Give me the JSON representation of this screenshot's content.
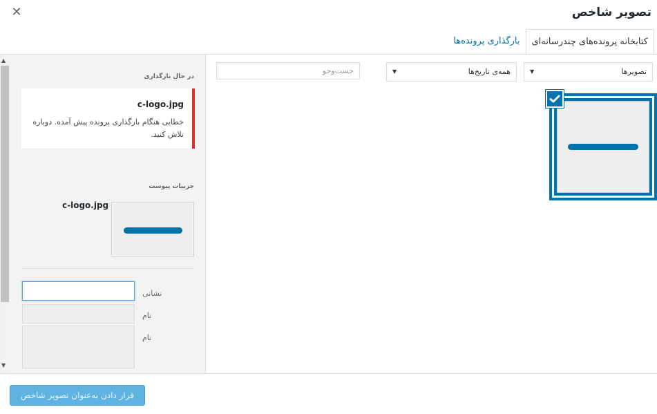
{
  "modal": {
    "title": "تصویر شاخص",
    "close_icon": "close-icon"
  },
  "tabs": [
    {
      "label": "بارگذاری پرونده‌ها",
      "active": false
    },
    {
      "label": "کتابخانه پرونده‌های چندرسانه‌ای",
      "active": true
    }
  ],
  "filters": {
    "type_select": "تصویرها",
    "date_select": "همه‌ی تاریخ‌ها",
    "search_placeholder": "جست‌وجو"
  },
  "sidebar": {
    "uploading_heading": "در حال بارگذاری",
    "upload_error": {
      "filename": "c-logo.jpg",
      "message": "خطایی هنگام بارگذاری پرونده پیش آمده. دوباره تلاش کنید."
    },
    "details_heading": "جزییات پیوست",
    "detail_filename": "c-logo.jpg",
    "fields": {
      "url_label": "نشانی",
      "name_label": "نام",
      "description_label": "نام"
    }
  },
  "toolbar": {
    "set_featured_label": "قرار دادن به‌عنوان تصویر شاخص"
  },
  "colors": {
    "accent": "#0073aa",
    "error": "#dc3232",
    "primary_disabled": "#5eb3e0"
  }
}
